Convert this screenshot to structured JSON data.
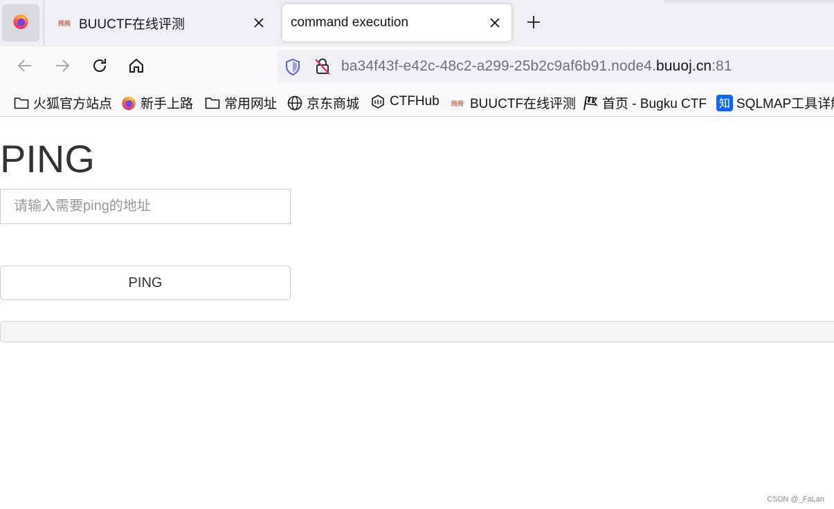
{
  "browser": {
    "tabs": [
      {
        "title": "BUUCTF在线评测",
        "active": false,
        "favicon": "buuctf-logo-icon",
        "favicon_text": "腾腾"
      },
      {
        "title": "command execution",
        "active": true
      }
    ],
    "url": {
      "prefix": "ba34f43f-e42c-48c2-a299-25b2c9af6b91.node4.",
      "host": "buuoj.cn",
      "port": ":81"
    },
    "bookmarks": [
      {
        "label": "火狐官方站点",
        "icon": "folder-icon"
      },
      {
        "label": "新手上路",
        "icon": "firefox-icon"
      },
      {
        "label": "常用网址",
        "icon": "folder-icon"
      },
      {
        "label": "京东商城",
        "icon": "globe-icon"
      },
      {
        "label": "CTFHub",
        "icon": "ctfhub-icon"
      },
      {
        "label": "BUUCTF在线评测",
        "icon": "buuctf-logo-icon"
      },
      {
        "label": "首页 - Bugku CTF",
        "icon": "checkered-flag-icon"
      },
      {
        "label": "SQLMAP工具详解",
        "icon": "zhihu-icon",
        "icon_text": "知"
      }
    ],
    "colors": {
      "strip": "#f0f0f4",
      "toolbar": "#f9f9fb",
      "shield": "#5b5bd6",
      "warning": "#e22850",
      "zhihu": "#0a66ff"
    }
  },
  "page": {
    "heading": "PING",
    "input": {
      "placeholder": "请输入需要ping的地址",
      "value": ""
    },
    "button_label": "PING",
    "result": ""
  },
  "watermark": "CSDN @_FaLan"
}
